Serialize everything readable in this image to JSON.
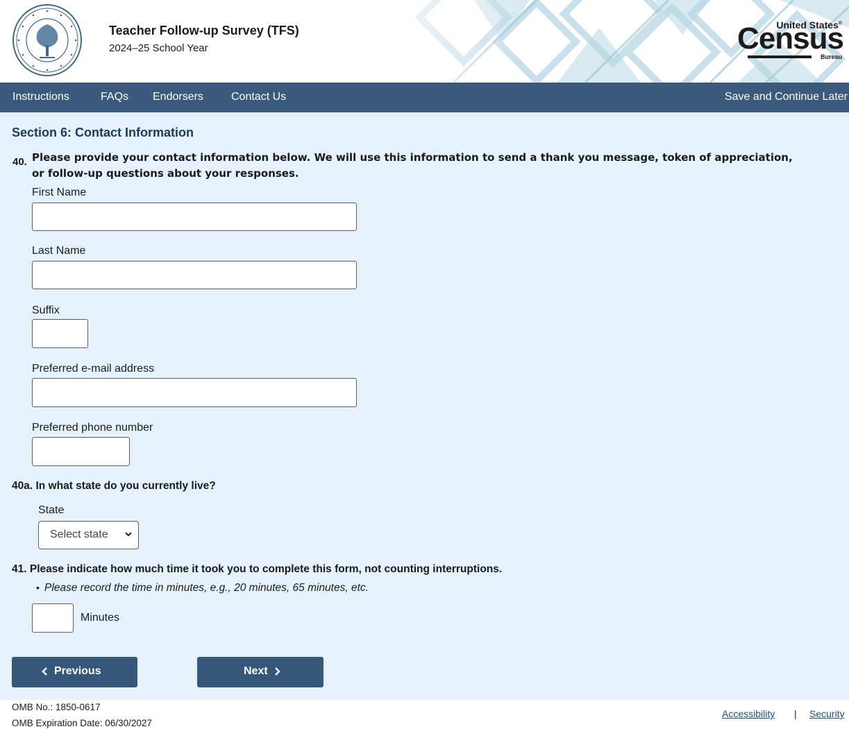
{
  "header": {
    "survey_title": "Teacher Follow-up Survey (TFS)",
    "school_year": "2024–25 School Year",
    "census_logo": {
      "united_states": "United States",
      "registered": "®",
      "census": "Census",
      "bureau": "Bureau"
    },
    "seal_icon": "department-of-education-seal"
  },
  "nav": {
    "instructions": "Instructions",
    "faqs": "FAQs",
    "endorsers": "Endorsers",
    "contact_us": "Contact Us",
    "save_continue": "Save and Continue Later"
  },
  "section": {
    "title": "Section 6: Contact Information"
  },
  "q40": {
    "number": "40.",
    "text_line1": "Please provide your contact information below. We will use this information to send a thank you message, token of appreciation,",
    "text_line2": "or follow-up questions about your responses.",
    "fields": {
      "first_name": {
        "label": "First Name",
        "value": ""
      },
      "last_name": {
        "label": "Last Name",
        "value": ""
      },
      "suffix": {
        "label": "Suffix",
        "value": ""
      },
      "email": {
        "label": "Preferred e-mail address",
        "value": ""
      },
      "phone": {
        "label": "Preferred phone number",
        "value": ""
      }
    }
  },
  "q40a": {
    "text": "40a. In what state do you currently live?",
    "state_label": "State",
    "state_selected": "Select state"
  },
  "q41": {
    "text": "41. Please indicate how much time it took you to complete this form, not counting interruptions.",
    "bullet": "•",
    "note": "Please record the time in minutes, e.g., 20 minutes, 65 minutes, etc.",
    "minutes_value": "",
    "minutes_label": "Minutes"
  },
  "buttons": {
    "previous": "Previous",
    "next": "Next"
  },
  "footer": {
    "omb_no": "OMB No.: 1850-0617",
    "omb_expiration": "OMB Expiration Date: 06/30/2027",
    "accessibility": "Accessibility",
    "separator": "|",
    "security": "Security"
  },
  "colors": {
    "nav_bg": "#3c5a7e",
    "content_bg": "#e5f2fb",
    "section_title": "#1a3a66",
    "button_bg": "#35577a",
    "link": "#1b4f8a"
  }
}
